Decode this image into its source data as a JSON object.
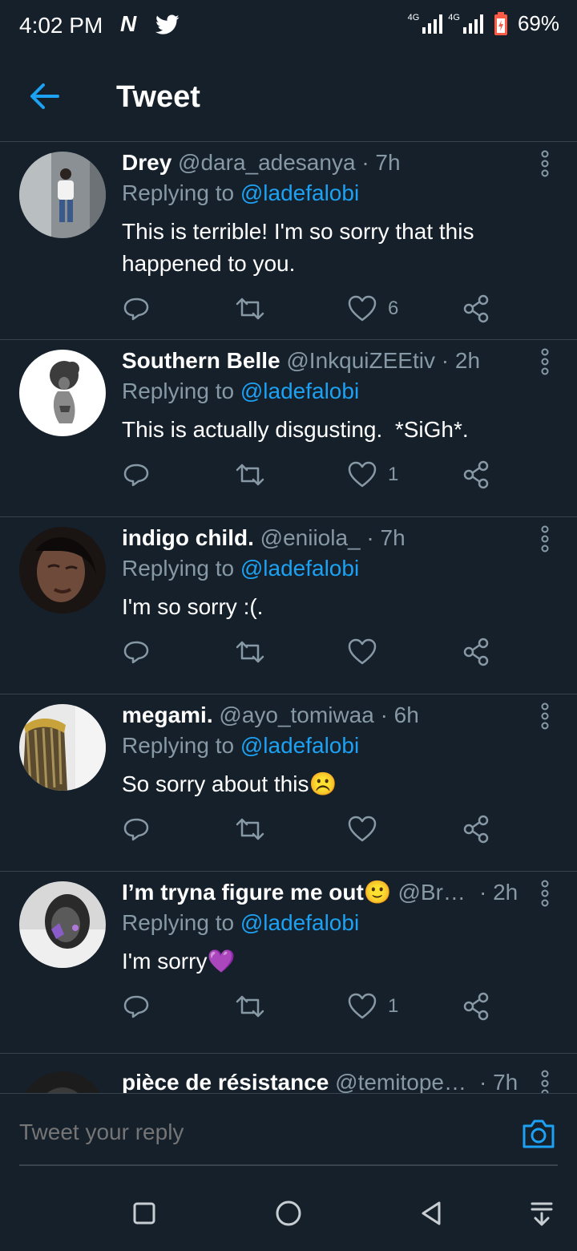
{
  "status_bar": {
    "time": "4:02 PM",
    "app_letter": "N",
    "network1": "4G",
    "network2": "4G",
    "battery": "69%"
  },
  "header": {
    "title": "Tweet",
    "back_icon": "arrow-left-icon"
  },
  "colors": {
    "background": "#15202b",
    "accent": "#1da1f2",
    "muted": "#8899a6",
    "divider": "#38444d"
  },
  "tweets": [
    {
      "name": "Drey",
      "handle": "@dara_adesanya",
      "time": "· 7h",
      "replying_prefix": "Replying to ",
      "replying_to": "@ladefalobi",
      "text": "This is terrible! I'm so sorry that this happened to you.",
      "likes": "6"
    },
    {
      "name": "Southern Belle",
      "handle": "@InkquiZEEtiv",
      "time": "· 2h",
      "replying_prefix": "Replying to ",
      "replying_to": "@ladefalobi",
      "text": "This is actually disgusting.  *SiGh*.",
      "likes": "1"
    },
    {
      "name": "indigo child.",
      "handle": "@eniiola_",
      "time": "· 7h",
      "replying_prefix": "Replying to ",
      "replying_to": "@ladefalobi",
      "text": "I'm so sorry :(.",
      "likes": ""
    },
    {
      "name": "megami.",
      "handle": "@ayo_tomiwaa",
      "time": "· 6h",
      "replying_prefix": "Replying to ",
      "replying_to": "@ladefalobi",
      "text": "So sorry about this☹️",
      "likes": ""
    },
    {
      "name": "I’m tryna figure me out🙂",
      "handle": "@Br…",
      "time": "· 2h",
      "replying_prefix": "Replying to ",
      "replying_to": "@ladefalobi",
      "text": "I'm sorry💜",
      "likes": "1"
    },
    {
      "name": "pièce de résistance",
      "handle": "@temitope…",
      "time": "· 7h"
    }
  ],
  "composer": {
    "placeholder": "Tweet your reply",
    "camera_icon": "camera-icon"
  },
  "navbar": {
    "icons": [
      "square-icon",
      "circle-icon",
      "triangle-back-icon",
      "notification-pull-icon"
    ]
  }
}
